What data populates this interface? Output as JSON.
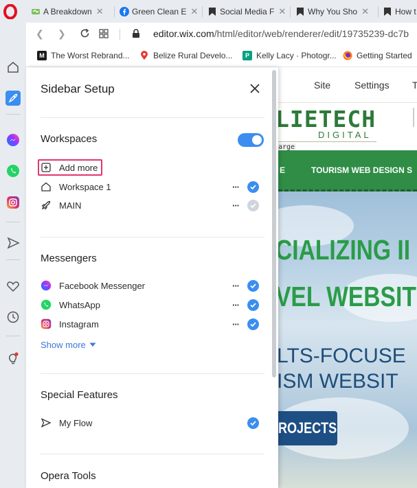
{
  "browser": {
    "tabs": [
      {
        "title": "A Breakdown",
        "icon": "wix-favicon-icon"
      },
      {
        "title": "Green Clean E",
        "icon": "facebook-icon"
      },
      {
        "title": "Social Media F",
        "icon": "bookmark-favicon-icon"
      },
      {
        "title": "Why You Sho",
        "icon": "bookmark-favicon-icon"
      },
      {
        "title": "How t",
        "icon": "bookmark-favicon-icon"
      }
    ],
    "url_host": "editor.wix.com",
    "url_path": "/html/editor/web/renderer/edit/19735239-dc7b",
    "bookmarks": [
      {
        "label": "The Worst Rebrand...",
        "icon": "medium-icon",
        "color": "#1a1a1a",
        "glyph": "M"
      },
      {
        "label": "Belize Rural Develo...",
        "icon": "map-pin-icon",
        "color": "#e53935"
      },
      {
        "label": "Kelly Lacy · Photogr...",
        "icon": "pexels-icon",
        "color": "#07a081",
        "glyph": "P"
      },
      {
        "label": "Getting Started",
        "icon": "firefox-icon",
        "color": "#ff7a1a"
      }
    ]
  },
  "opera_sidebar": {
    "icons": [
      "home-icon",
      "flow-rocket-icon",
      "messenger-icon",
      "whatsapp-icon",
      "instagram-icon",
      "send-icon",
      "heart-icon",
      "history-clock-icon",
      "tips-bulb-icon"
    ]
  },
  "panel": {
    "title": "Sidebar Setup",
    "workspaces": {
      "heading": "Workspaces",
      "toggle_on": true,
      "add_more": "Add more",
      "items": [
        {
          "label": "Workspace 1",
          "checked": true
        },
        {
          "label": "MAIN",
          "checked": false
        }
      ]
    },
    "messengers": {
      "heading": "Messengers",
      "items": [
        {
          "label": "Facebook Messenger",
          "checked": true
        },
        {
          "label": "WhatsApp",
          "checked": true
        },
        {
          "label": "Instagram",
          "checked": true
        }
      ],
      "show_more": "Show more"
    },
    "special_features": {
      "heading": "Special Features",
      "items": [
        {
          "label": "My Flow",
          "checked": true
        }
      ]
    },
    "opera_tools": {
      "heading": "Opera Tools"
    }
  },
  "website": {
    "menu": [
      "Site",
      "Settings",
      "T"
    ],
    "logo_main": "LIETECH",
    "logo_sub": "DIGITAL",
    "large_tag": "arge",
    "nav": [
      "E",
      "TOURISM WEB DESIGN S"
    ],
    "headline_1": "CIALIZING II",
    "headline_2": "VEL WEBSIT",
    "sub_1": "LTS-FOCUSE",
    "sub_2": "ISM WEBSIT",
    "button": "ROJECTS"
  },
  "colors": {
    "accent": "#3b8ef0",
    "highlight_border": "#e2356f",
    "brand_green": "#2f8d46",
    "brand_blue": "#1d4f84"
  }
}
